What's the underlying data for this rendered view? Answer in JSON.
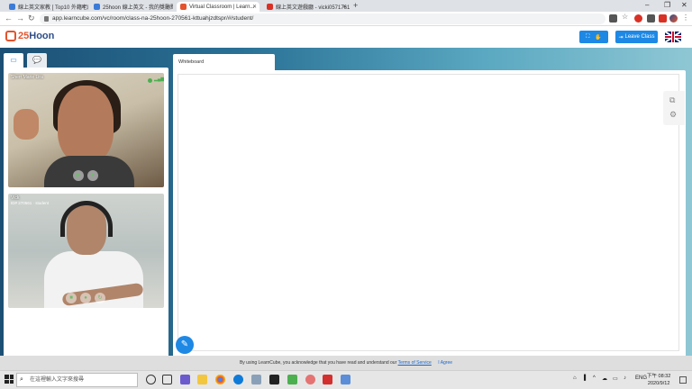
{
  "browser": {
    "tabs": [
      {
        "title": "線上英文家教 [ Top10 外籍老師...",
        "color": "#3b7bd8"
      },
      {
        "title": "25hoon 線上英文 - 我的獎勵點...",
        "color": "#3b7bd8"
      },
      {
        "title": "Virtual Classroom | Learn...",
        "color": "#e4532d"
      },
      {
        "title": "線上英文遊戲廳 - vicki0571761...",
        "color": "#d93025"
      }
    ],
    "url": "app.learncube.com/vc/room/class-na-25hoon-270561-kttuahjzdtspr/#/student/"
  },
  "app": {
    "logo_text": "Hoon",
    "logo_number": "25",
    "leave_label": "Leave Class",
    "colors": {
      "accent": "#1e88e5",
      "brand": "#e4532d"
    }
  },
  "left_tabs": [
    {
      "icon": "video-camera-icon"
    },
    {
      "icon": "chat-bubbles-icon"
    }
  ],
  "videos": [
    {
      "name": "Sherr Marie Lira",
      "role": "teacher"
    },
    {
      "name": "Vick",
      "sub": "ID# 270561 · student"
    }
  ],
  "whiteboard": {
    "tab_label": "Whiteboard"
  },
  "cookie": {
    "text": "By using LearnCube, you acknowledge that you have read and understand our",
    "link": "Terms of Service",
    "agree": "I Agree"
  },
  "taskbar": {
    "search_placeholder": "在這裡輸入文字來搜尋",
    "lang": "ENG",
    "time": "下午 08:32",
    "date": "2020/9/12"
  }
}
